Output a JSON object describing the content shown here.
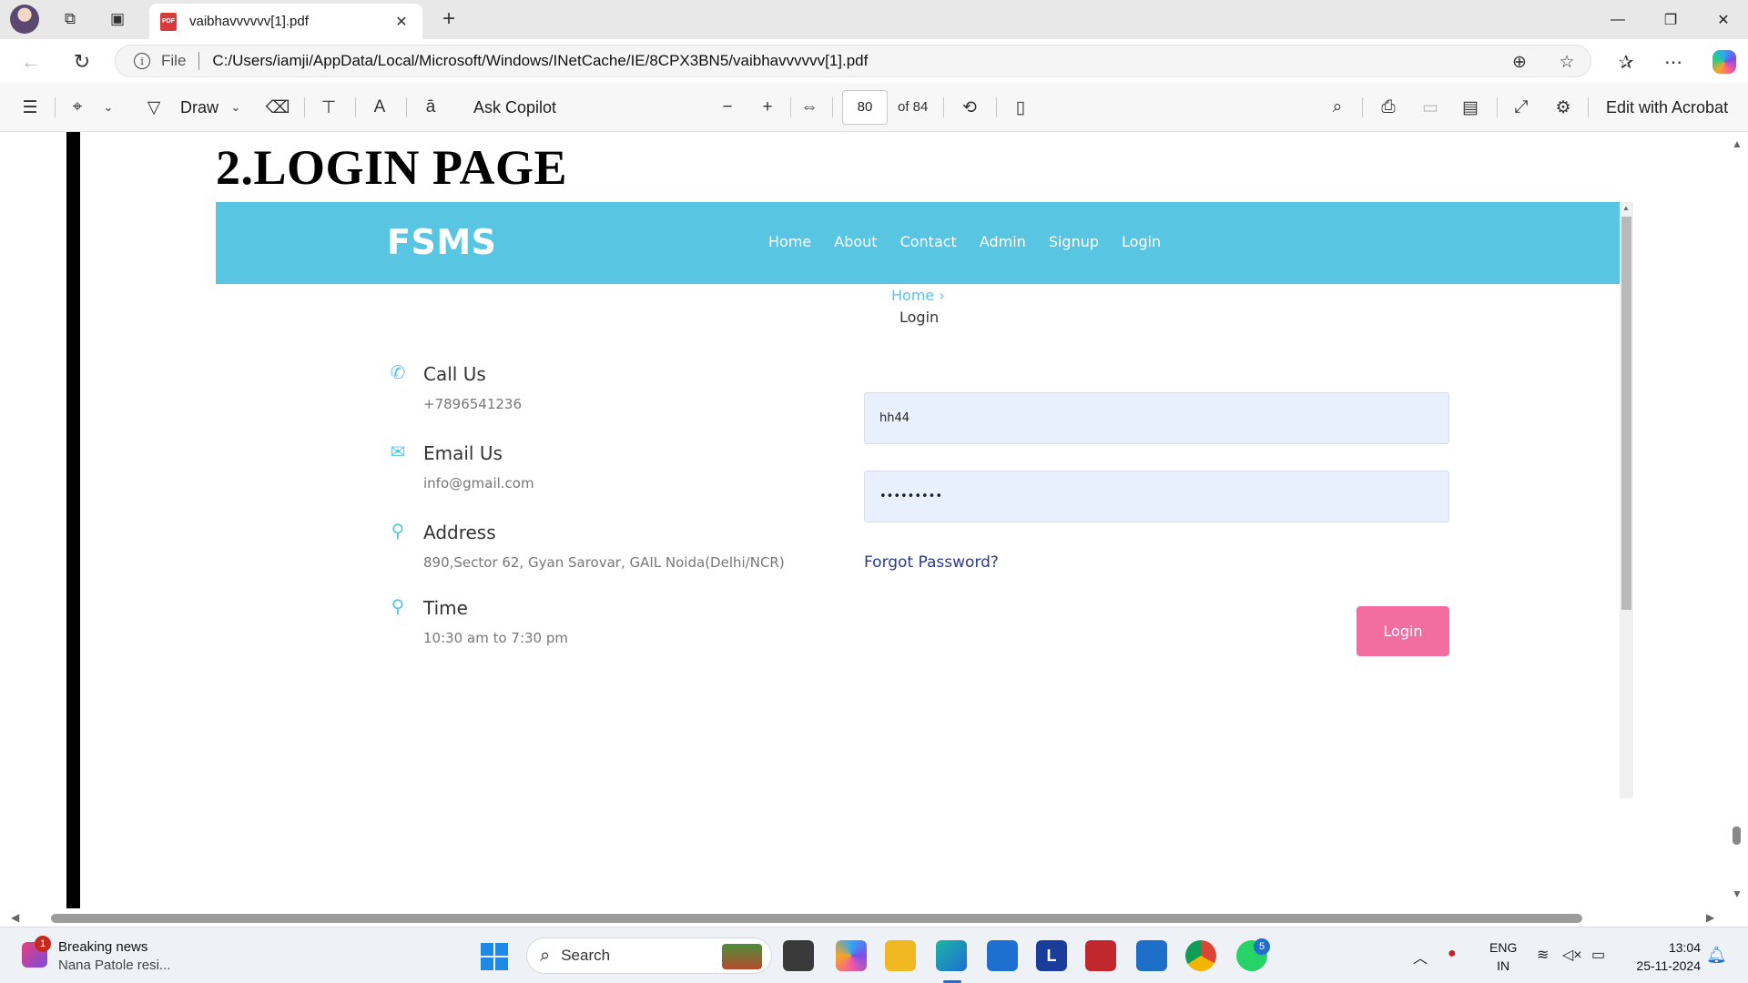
{
  "browser": {
    "tab_title": "vaibhavvvvvv[1].pdf",
    "pdf_badge": "PDF",
    "scheme_label": "File",
    "url": "C:/Users/iamji/AppData/Local/Microsoft/Windows/INetCache/IE/8CPX3BN5/vaibhavvvvvv[1].pdf"
  },
  "pdf_toolbar": {
    "draw_label": "Draw",
    "ask_copilot_label": "Ask Copilot",
    "page_number": "80",
    "page_total": "of 84",
    "edit_label": "Edit with Acrobat"
  },
  "document": {
    "heading": "2.LOGIN PAGE"
  },
  "site": {
    "logo": "FSMS",
    "accent_color": "#58c5e2",
    "button_color": "#f36ea0",
    "menu": [
      "Home",
      "About",
      "Contact",
      "Admin",
      "Signup",
      "Login"
    ],
    "breadcrumb_home": "Home",
    "breadcrumb_current": "Login",
    "contact": [
      {
        "title": "Call Us",
        "text": "+7896541236",
        "icon": "phone-icon"
      },
      {
        "title": "Email Us",
        "text": "info@gmail.com",
        "icon": "envelope-icon"
      },
      {
        "title": "Address",
        "text": "890,Sector 62, Gyan Sarovar, GAIL Noida(Delhi/NCR)",
        "icon": "location-pin-icon"
      },
      {
        "title": "Time",
        "text": "10:30 am to 7:30 pm",
        "icon": "location-pin-icon"
      }
    ],
    "username_value": "hh44",
    "password_value": "•••••••••",
    "forgot_label": "Forgot Password?",
    "login_button": "Login"
  },
  "taskbar": {
    "news_badge": "1",
    "news_title": "Breaking news",
    "news_sub": "Nana Patole resi...",
    "search_label": "Search",
    "whatsapp_badge": "5",
    "lang_line1": "ENG",
    "lang_line2": "IN",
    "time": "13:04",
    "date": "25-11-2024"
  }
}
